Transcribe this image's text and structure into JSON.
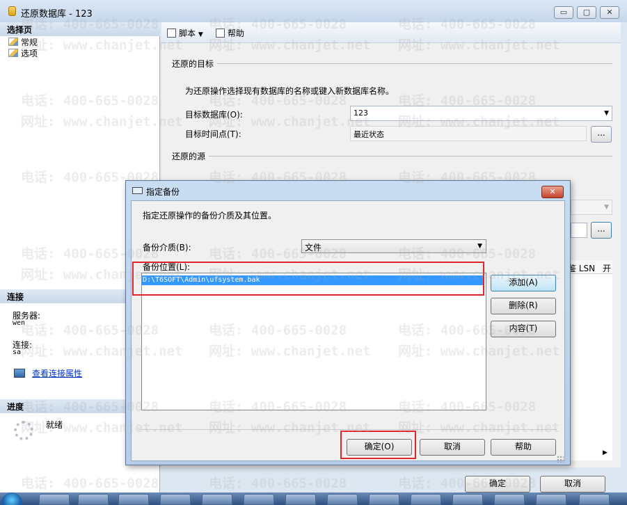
{
  "window": {
    "title": "还原数据库 - 123",
    "minimize": "▭",
    "maximize": "▢",
    "close": "✕"
  },
  "left": {
    "select_page_header": "选择页",
    "pages": [
      "常规",
      "选项"
    ],
    "connection_header": "连接",
    "server_label": "服务器:",
    "server_value": "wen",
    "connection_label": "连接:",
    "connection_value": "sa",
    "view_props_link": "查看连接属性",
    "progress_header": "进度",
    "progress_status": "就绪"
  },
  "toolbar": {
    "script_label": "脚本",
    "help_label": "帮助"
  },
  "main": {
    "restore_target_header": "还原的目标",
    "restore_target_desc": "为还原操作选择现有数据库的名称或键入新数据库名称。",
    "target_db_label": "目标数据库(O):",
    "target_db_value": "123",
    "target_time_label": "目标时间点(T):",
    "target_time_value": "最近状态",
    "ellipsis": "...",
    "restore_source_header": "还原的源",
    "grid_col_lsn": "鉴 LSN",
    "grid_col_open": "开"
  },
  "bottom": {
    "ok_label": "确定",
    "cancel_label": "取消"
  },
  "dialog": {
    "title": "指定备份",
    "close": "✕",
    "description": "指定还原操作的备份介质及其位置。",
    "media_label": "备份介质(B):",
    "media_value": "文件",
    "location_label": "备份位置(L):",
    "location_items": [
      "D:\\T6SOFT\\Admin\\ufsystem.bak"
    ],
    "add_label": "添加(A)",
    "remove_label": "删除(R)",
    "contents_label": "内容(T)",
    "ok_label": "确定(O)",
    "cancel_label": "取消",
    "help_label": "帮助"
  },
  "watermark": {
    "phone": "电话: 400-665-0028",
    "site": "网址: www.chanjet.net"
  },
  "taskbar": {
    "icons": [
      "start-orb",
      "t6-app",
      "color-app",
      "explorer",
      "media",
      "powerpoint",
      "t-plus",
      "excel",
      "word",
      "doc-app",
      "draw-app",
      "red-app",
      "red-app-2",
      "window-app",
      "pen-app"
    ]
  }
}
